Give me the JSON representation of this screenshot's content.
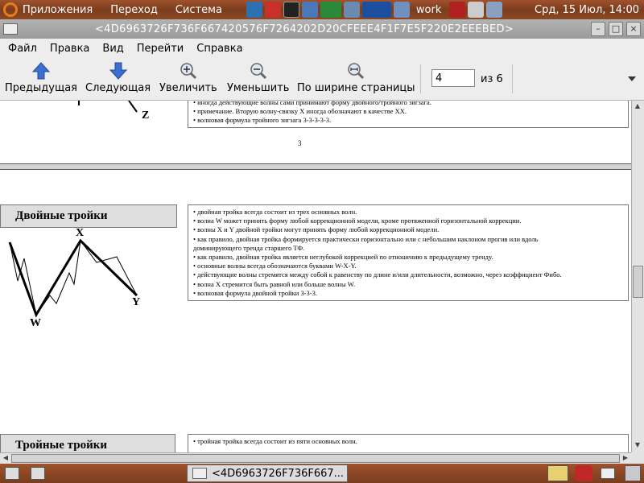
{
  "panel": {
    "menus": [
      "Приложения",
      "Переход",
      "Система"
    ],
    "workspace": "work",
    "clock": "Срд, 15 Июл, 14:00",
    "colors": {
      "panel": "#8a4a25",
      "logo": "#e87c1e"
    }
  },
  "window": {
    "title": "<4D6963726F736F667420576F7264202D20CFEEE4F1F7E5F220E2EEEBED>",
    "buttons": [
      "minimize-icon",
      "maximize-icon",
      "close-icon"
    ]
  },
  "menubar": [
    "Файл",
    "Правка",
    "Вид",
    "Перейти",
    "Справка"
  ],
  "toolbar": {
    "prev": "Предыдущая",
    "next": "Следующая",
    "zoom_in": "Увеличить",
    "zoom_out": "Уменьшить",
    "fit_width": "По ширине страницы",
    "page_value": "4",
    "of_label": "из 6"
  },
  "document": {
    "page3": {
      "label_z": "Z",
      "lines": [
        "• иногда действующие волны сами принимают форму двойного/тройного зигзага.",
        "• примечание. Вторую волну-связку X иногда обозначают в качестве XX.",
        "• волновая формула тройного зигзага 3-3-3-3-3."
      ],
      "page_number": "3"
    },
    "page4": {
      "double_header": "Двойные тройки",
      "double_lines": [
        "• двойная тройка всегда состоит из трех основных волн.",
        "• волна W может принять форму любой коррекционной модели, кроме протяженной горизонтальной коррекции.",
        "• волны X и Y двойной тройки могут принять форму любой коррекционной модели.",
        "• как правило, двойная тройка формируется практически горизонтально или с небольшим наклоном прогив или вдоль",
        "доминирующего тренда старшего ТФ.",
        "• как правило, двойная тройка является неглубокой коррекцией по отношению к предыдущему тренду.",
        "• основные волны всегда обозначаются буквами W-X-Y.",
        "• действующие волны стремятся между собой к равенству по длине и/или длительности, возможно, через коэффициент Фибо.",
        "• волна X стремится быть равной или больше волны W.",
        "• волновая формула двойной тройки 3-3-3."
      ],
      "labels": {
        "w": "W",
        "x": "X",
        "y": "Y"
      },
      "triple_header": "Тройные тройки",
      "triple_lines": [
        "• тройная тройка всегда состоит из пяти основных волн."
      ]
    }
  },
  "taskbar": {
    "task_title": "<4D6963726F736F667...",
    "tray": [
      "keyboard-icon",
      "power-icon",
      "window-icon"
    ]
  }
}
